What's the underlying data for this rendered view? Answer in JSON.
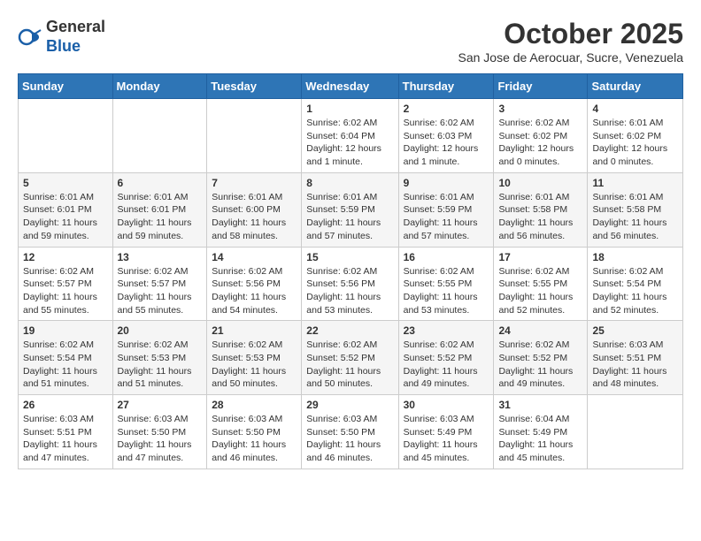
{
  "header": {
    "logo_line1": "General",
    "logo_line2": "Blue",
    "month": "October 2025",
    "location": "San Jose de Aerocuar, Sucre, Venezuela"
  },
  "days_of_week": [
    "Sunday",
    "Monday",
    "Tuesday",
    "Wednesday",
    "Thursday",
    "Friday",
    "Saturday"
  ],
  "weeks": [
    [
      {
        "day": "",
        "content": ""
      },
      {
        "day": "",
        "content": ""
      },
      {
        "day": "",
        "content": ""
      },
      {
        "day": "1",
        "content": "Sunrise: 6:02 AM\nSunset: 6:04 PM\nDaylight: 12 hours\nand 1 minute."
      },
      {
        "day": "2",
        "content": "Sunrise: 6:02 AM\nSunset: 6:03 PM\nDaylight: 12 hours\nand 1 minute."
      },
      {
        "day": "3",
        "content": "Sunrise: 6:02 AM\nSunset: 6:02 PM\nDaylight: 12 hours\nand 0 minutes."
      },
      {
        "day": "4",
        "content": "Sunrise: 6:01 AM\nSunset: 6:02 PM\nDaylight: 12 hours\nand 0 minutes."
      }
    ],
    [
      {
        "day": "5",
        "content": "Sunrise: 6:01 AM\nSunset: 6:01 PM\nDaylight: 11 hours\nand 59 minutes."
      },
      {
        "day": "6",
        "content": "Sunrise: 6:01 AM\nSunset: 6:01 PM\nDaylight: 11 hours\nand 59 minutes."
      },
      {
        "day": "7",
        "content": "Sunrise: 6:01 AM\nSunset: 6:00 PM\nDaylight: 11 hours\nand 58 minutes."
      },
      {
        "day": "8",
        "content": "Sunrise: 6:01 AM\nSunset: 5:59 PM\nDaylight: 11 hours\nand 57 minutes."
      },
      {
        "day": "9",
        "content": "Sunrise: 6:01 AM\nSunset: 5:59 PM\nDaylight: 11 hours\nand 57 minutes."
      },
      {
        "day": "10",
        "content": "Sunrise: 6:01 AM\nSunset: 5:58 PM\nDaylight: 11 hours\nand 56 minutes."
      },
      {
        "day": "11",
        "content": "Sunrise: 6:01 AM\nSunset: 5:58 PM\nDaylight: 11 hours\nand 56 minutes."
      }
    ],
    [
      {
        "day": "12",
        "content": "Sunrise: 6:02 AM\nSunset: 5:57 PM\nDaylight: 11 hours\nand 55 minutes."
      },
      {
        "day": "13",
        "content": "Sunrise: 6:02 AM\nSunset: 5:57 PM\nDaylight: 11 hours\nand 55 minutes."
      },
      {
        "day": "14",
        "content": "Sunrise: 6:02 AM\nSunset: 5:56 PM\nDaylight: 11 hours\nand 54 minutes."
      },
      {
        "day": "15",
        "content": "Sunrise: 6:02 AM\nSunset: 5:56 PM\nDaylight: 11 hours\nand 53 minutes."
      },
      {
        "day": "16",
        "content": "Sunrise: 6:02 AM\nSunset: 5:55 PM\nDaylight: 11 hours\nand 53 minutes."
      },
      {
        "day": "17",
        "content": "Sunrise: 6:02 AM\nSunset: 5:55 PM\nDaylight: 11 hours\nand 52 minutes."
      },
      {
        "day": "18",
        "content": "Sunrise: 6:02 AM\nSunset: 5:54 PM\nDaylight: 11 hours\nand 52 minutes."
      }
    ],
    [
      {
        "day": "19",
        "content": "Sunrise: 6:02 AM\nSunset: 5:54 PM\nDaylight: 11 hours\nand 51 minutes."
      },
      {
        "day": "20",
        "content": "Sunrise: 6:02 AM\nSunset: 5:53 PM\nDaylight: 11 hours\nand 51 minutes."
      },
      {
        "day": "21",
        "content": "Sunrise: 6:02 AM\nSunset: 5:53 PM\nDaylight: 11 hours\nand 50 minutes."
      },
      {
        "day": "22",
        "content": "Sunrise: 6:02 AM\nSunset: 5:52 PM\nDaylight: 11 hours\nand 50 minutes."
      },
      {
        "day": "23",
        "content": "Sunrise: 6:02 AM\nSunset: 5:52 PM\nDaylight: 11 hours\nand 49 minutes."
      },
      {
        "day": "24",
        "content": "Sunrise: 6:02 AM\nSunset: 5:52 PM\nDaylight: 11 hours\nand 49 minutes."
      },
      {
        "day": "25",
        "content": "Sunrise: 6:03 AM\nSunset: 5:51 PM\nDaylight: 11 hours\nand 48 minutes."
      }
    ],
    [
      {
        "day": "26",
        "content": "Sunrise: 6:03 AM\nSunset: 5:51 PM\nDaylight: 11 hours\nand 47 minutes."
      },
      {
        "day": "27",
        "content": "Sunrise: 6:03 AM\nSunset: 5:50 PM\nDaylight: 11 hours\nand 47 minutes."
      },
      {
        "day": "28",
        "content": "Sunrise: 6:03 AM\nSunset: 5:50 PM\nDaylight: 11 hours\nand 46 minutes."
      },
      {
        "day": "29",
        "content": "Sunrise: 6:03 AM\nSunset: 5:50 PM\nDaylight: 11 hours\nand 46 minutes."
      },
      {
        "day": "30",
        "content": "Sunrise: 6:03 AM\nSunset: 5:49 PM\nDaylight: 11 hours\nand 45 minutes."
      },
      {
        "day": "31",
        "content": "Sunrise: 6:04 AM\nSunset: 5:49 PM\nDaylight: 11 hours\nand 45 minutes."
      },
      {
        "day": "",
        "content": ""
      }
    ]
  ]
}
